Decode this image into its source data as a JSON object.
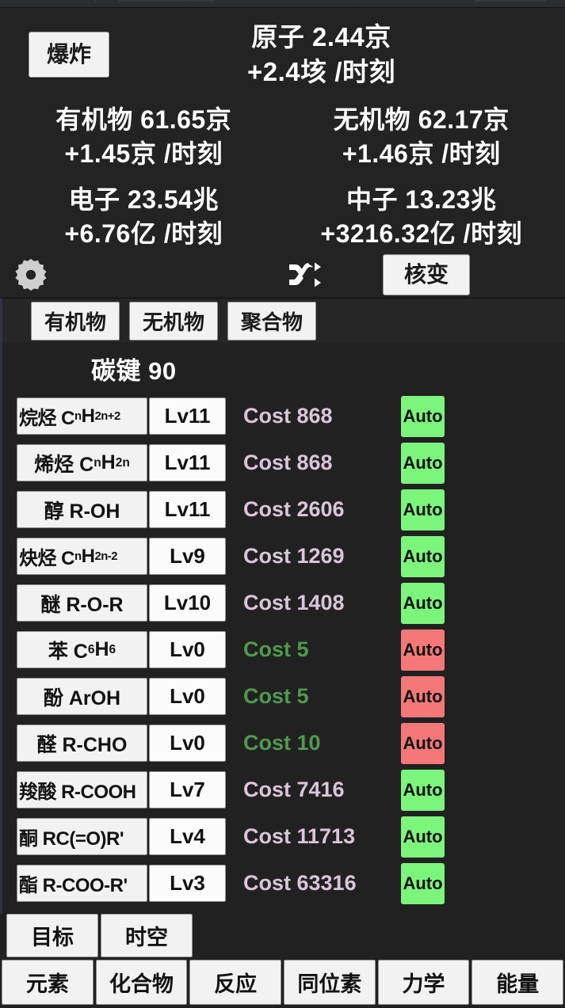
{
  "header": {
    "explode_button": "爆炸",
    "atoms_label": "原子 2.44京",
    "atoms_rate": "+2.4垓 /时刻",
    "resources": [
      {
        "name": "organic",
        "amount": "有机物 61.65京",
        "rate": "+1.45京 /时刻"
      },
      {
        "name": "inorganic",
        "amount": "无机物 62.17京",
        "rate": "+1.46京 /时刻"
      },
      {
        "name": "electron",
        "amount": "电子 23.54兆",
        "rate": "+6.76亿 /时刻"
      },
      {
        "name": "neutron",
        "amount": "中子 13.23兆",
        "rate": "+3216.32亿 /时刻"
      }
    ]
  },
  "controlbar": {
    "gear_icon": "gear-icon",
    "shuffle_icon": "shuffle-icon",
    "fission_button": "核变"
  },
  "tabs": [
    {
      "label": "有机物"
    },
    {
      "label": "无机物"
    },
    {
      "label": "聚合物"
    }
  ],
  "section": {
    "title": "碳键 90"
  },
  "items": [
    {
      "name": "烷烃 C",
      "sub1": "n",
      "mid": "H",
      "sub2": "2n+2",
      "tail": "",
      "level": "Lv11",
      "cost": "Cost 868",
      "affordable": false,
      "auto": "Auto",
      "auto_on": true
    },
    {
      "name": "烯烃 C",
      "sub1": "n",
      "mid": "H",
      "sub2": "2n",
      "tail": "",
      "level": "Lv11",
      "cost": "Cost 868",
      "affordable": false,
      "auto": "Auto",
      "auto_on": true
    },
    {
      "name": "醇 R-OH",
      "sub1": "",
      "mid": "",
      "sub2": "",
      "tail": "",
      "level": "Lv11",
      "cost": "Cost 2606",
      "affordable": false,
      "auto": "Auto",
      "auto_on": true
    },
    {
      "name": "炔烃 C",
      "sub1": "n",
      "mid": "H",
      "sub2": "2n-2",
      "tail": "",
      "level": "Lv9",
      "cost": "Cost 1269",
      "affordable": false,
      "auto": "Auto",
      "auto_on": true
    },
    {
      "name": "醚 R-O-R",
      "sub1": "",
      "mid": "",
      "sub2": "",
      "tail": "",
      "level": "Lv10",
      "cost": "Cost 1408",
      "affordable": false,
      "auto": "Auto",
      "auto_on": true
    },
    {
      "name": "苯 C",
      "sub1": "6",
      "mid": "H",
      "sub2": "6",
      "tail": "",
      "level": "Lv0",
      "cost": "Cost 5",
      "affordable": true,
      "auto": "Auto",
      "auto_on": false
    },
    {
      "name": "酚 ArOH",
      "sub1": "",
      "mid": "",
      "sub2": "",
      "tail": "",
      "level": "Lv0",
      "cost": "Cost 5",
      "affordable": true,
      "auto": "Auto",
      "auto_on": false
    },
    {
      "name": "醛 R-CHO",
      "sub1": "",
      "mid": "",
      "sub2": "",
      "tail": "",
      "level": "Lv0",
      "cost": "Cost 10",
      "affordable": true,
      "auto": "Auto",
      "auto_on": false
    },
    {
      "name": "羧酸 R-COOH",
      "sub1": "",
      "mid": "",
      "sub2": "",
      "tail": "",
      "level": "Lv7",
      "cost": "Cost 7416",
      "affordable": false,
      "auto": "Auto",
      "auto_on": true
    },
    {
      "name": "酮 RC(=O)R'",
      "sub1": "",
      "mid": "",
      "sub2": "",
      "tail": "",
      "level": "Lv4",
      "cost": "Cost 11713",
      "affordable": false,
      "auto": "Auto",
      "auto_on": true
    },
    {
      "name": "酯 R-COO-R'",
      "sub1": "",
      "mid": "",
      "sub2": "",
      "tail": "",
      "level": "Lv3",
      "cost": "Cost 63316",
      "affordable": false,
      "auto": "Auto",
      "auto_on": true
    }
  ],
  "bottom_nav": {
    "row1": [
      {
        "label": "目标"
      },
      {
        "label": "时空"
      }
    ],
    "row2": [
      {
        "label": "元素"
      },
      {
        "label": "化合物"
      },
      {
        "label": "反应"
      },
      {
        "label": "同位素"
      },
      {
        "label": "力学"
      },
      {
        "label": "能量"
      }
    ]
  },
  "colors": {
    "background": "#232323",
    "panel": "#212121",
    "button_face": "#f2f2f2",
    "auto_on": "#7cf57c",
    "auto_off": "#f57878",
    "cost_affordable": "#4f9a4f",
    "cost_expensive": "#d9c6d8",
    "accent_edge": "#2f3440"
  }
}
